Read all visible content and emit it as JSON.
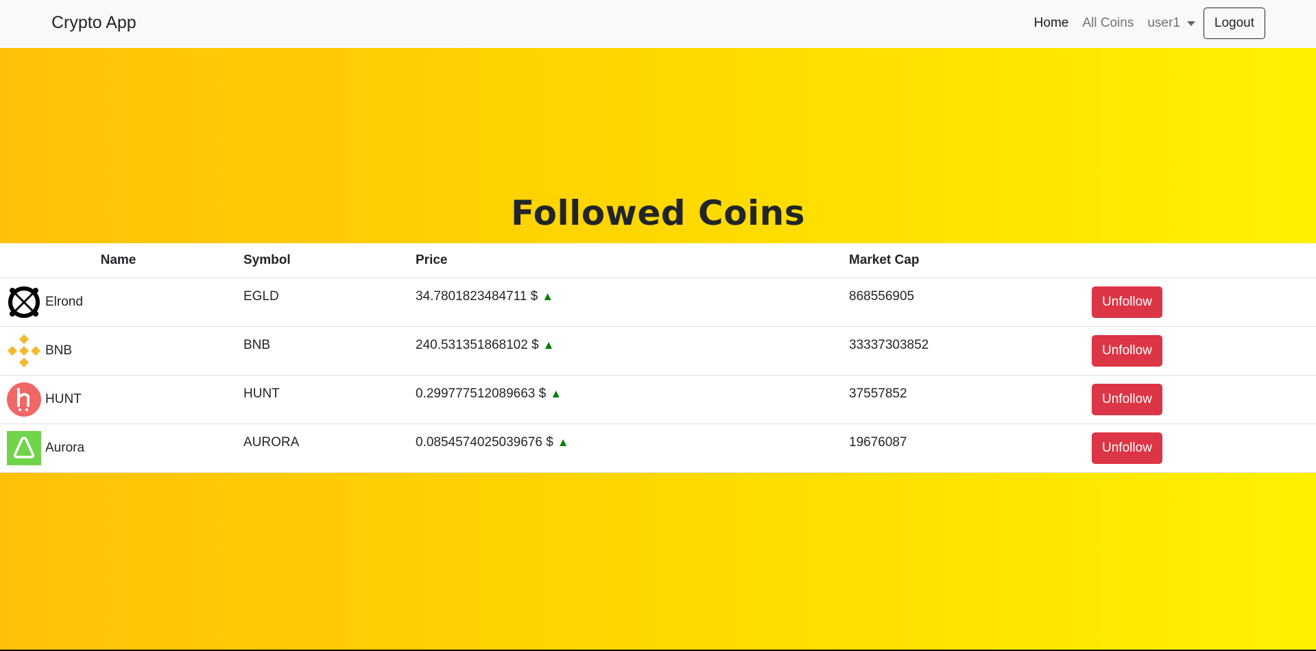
{
  "nav": {
    "brand": "Crypto App",
    "home": "Home",
    "all_coins": "All Coins",
    "user": "user1",
    "logout": "Logout"
  },
  "page_title": "Followed Coins",
  "table": {
    "headers": [
      "Name",
      "Symbol",
      "Price",
      "Market Cap",
      ""
    ],
    "rows": [
      {
        "name": "Elrond",
        "symbol": "EGLD",
        "price": "34.7801823484711 $",
        "trend": "▲",
        "market_cap": "868556905",
        "action": "Unfollow",
        "logo": "elrond-logo-icon"
      },
      {
        "name": "BNB",
        "symbol": "BNB",
        "price": "240.531351868102 $",
        "trend": "▲",
        "market_cap": "33337303852",
        "action": "Unfollow",
        "logo": "bnb-logo-icon"
      },
      {
        "name": "HUNT",
        "symbol": "HUNT",
        "price": "0.299777512089663 $",
        "trend": "▲",
        "market_cap": "37557852",
        "action": "Unfollow",
        "logo": "hunt-logo-icon"
      },
      {
        "name": "Aurora",
        "symbol": "AURORA",
        "price": "0.0854574025039676 $",
        "trend": "▲",
        "market_cap": "19676087",
        "action": "Unfollow",
        "logo": "aurora-logo-icon"
      }
    ]
  },
  "colors": {
    "gradient_start": "#ffc107",
    "gradient_end": "#fff100",
    "unfollow": "#dc3545",
    "trend_up": "#008000"
  }
}
